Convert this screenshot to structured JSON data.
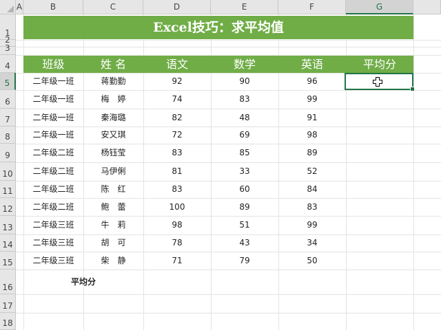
{
  "sheet": {
    "columns": [
      "A",
      "B",
      "C",
      "D",
      "E",
      "F",
      "G"
    ],
    "rows": [
      "1",
      "2",
      "3",
      "4",
      "5",
      "6",
      "7",
      "8",
      "9",
      "10",
      "11",
      "12",
      "13",
      "14",
      "15",
      "16",
      "17",
      "18"
    ],
    "selected_column": "G",
    "selected_row": "5",
    "active_cell": "G5"
  },
  "title": "Excel技巧：求平均值",
  "header": {
    "class": "班级",
    "name": "姓 名",
    "chinese": "语文",
    "math": "数学",
    "english": "英语",
    "average": "平均分"
  },
  "students": [
    {
      "class": "二年级一班",
      "name": "蒋勤勤",
      "chinese": "92",
      "math": "90",
      "english": "96"
    },
    {
      "class": "二年级一班",
      "name": "梅　婷",
      "chinese": "74",
      "math": "83",
      "english": "99"
    },
    {
      "class": "二年级一班",
      "name": "秦海璐",
      "chinese": "82",
      "math": "48",
      "english": "91"
    },
    {
      "class": "二年级一班",
      "name": "安又琪",
      "chinese": "72",
      "math": "69",
      "english": "98"
    },
    {
      "class": "二年级二班",
      "name": "杨钰莹",
      "chinese": "83",
      "math": "85",
      "english": "89"
    },
    {
      "class": "二年级二班",
      "name": "马伊俐",
      "chinese": "81",
      "math": "33",
      "english": "52"
    },
    {
      "class": "二年级二班",
      "name": "陈　红",
      "chinese": "83",
      "math": "60",
      "english": "84"
    },
    {
      "class": "二年级二班",
      "name": "鲍　蕾",
      "chinese": "100",
      "math": "89",
      "english": "83"
    },
    {
      "class": "二年级三班",
      "name": "牛　莉",
      "chinese": "98",
      "math": "51",
      "english": "99"
    },
    {
      "class": "二年级三班",
      "name": "胡　可",
      "chinese": "78",
      "math": "43",
      "english": "34"
    },
    {
      "class": "二年级三班",
      "name": "柴　静",
      "chinese": "71",
      "math": "79",
      "english": "50"
    }
  ],
  "average_label": "平均分",
  "colors": {
    "accent_green": "#70ad47",
    "selection_green": "#217346"
  },
  "cursor_icon": "cell-select-cross-icon"
}
